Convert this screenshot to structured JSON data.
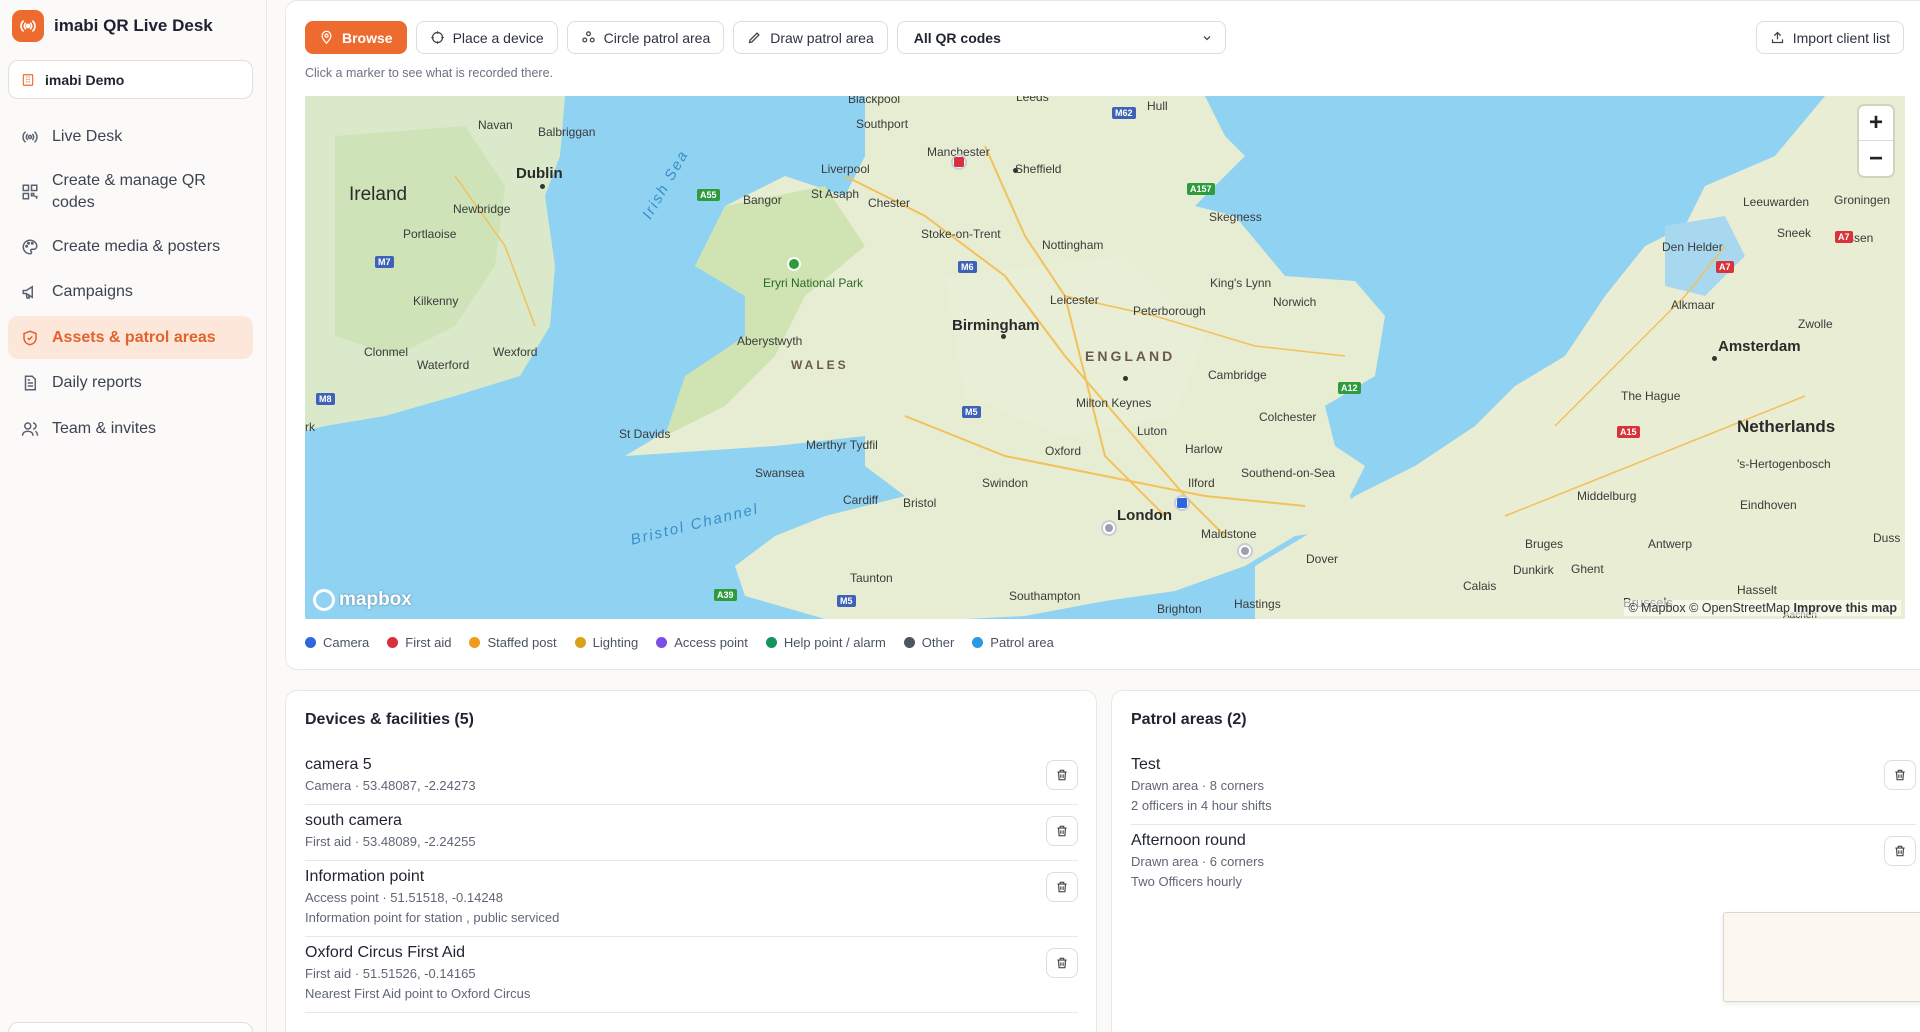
{
  "app": {
    "name": "imabi QR Live Desk",
    "org": "imabi Demo",
    "accent": "#ee6b2f"
  },
  "nav": [
    {
      "label": "Live Desk",
      "icon": "broadcast-icon"
    },
    {
      "label": "Create & manage QR codes",
      "icon": "qr-code-icon"
    },
    {
      "label": "Create media & posters",
      "icon": "palette-icon"
    },
    {
      "label": "Campaigns",
      "icon": "megaphone-icon"
    },
    {
      "label": "Assets & patrol areas",
      "icon": "shield-icon",
      "active": true
    },
    {
      "label": "Daily reports",
      "icon": "document-icon"
    },
    {
      "label": "Team & invites",
      "icon": "users-icon"
    }
  ],
  "toolbar": {
    "browse": "Browse",
    "place_device": "Place a device",
    "circle_patrol": "Circle patrol area",
    "draw_patrol": "Draw patrol area",
    "filter_value": "All QR codes",
    "import": "Import client list",
    "hint": "Click a marker to see what is recorded there."
  },
  "map": {
    "countries": {
      "ireland": "Ireland",
      "netherlands": "Netherlands"
    },
    "regions": {
      "england": "ENGLAND",
      "wales": "WALES"
    },
    "seas": {
      "irish_sea": "Irish Sea",
      "bristol_channel": "Bristol Channel"
    },
    "places": {
      "dublin": "Dublin",
      "navan": "Navan",
      "balbriggan": "Balbriggan",
      "newbridge": "Newbridge",
      "portlaoise": "Portlaoise",
      "kilkenny": "Kilkenny",
      "clonmel": "Clonmel",
      "waterford": "Waterford",
      "wexford": "Wexford",
      "cork": "rk",
      "blackpool": "Blackpool",
      "southport": "Southport",
      "liverpool": "Liverpool",
      "manchester": "Manchester",
      "leeds": "Leeds",
      "hull": "Hull",
      "sheffield": "Sheffield",
      "bangor": "Bangor",
      "st_asaph": "St Asaph",
      "chester": "Chester",
      "stoke": "Stoke-on-Trent",
      "nottingham": "Nottingham",
      "skegness": "Skegness",
      "eryri": "Eryri National Park",
      "kings_lynn": "King's Lynn",
      "norwich": "Norwich",
      "leicester": "Leicester",
      "birmingham": "Birmingham",
      "peterborough": "Peterborough",
      "aberystwyth": "Aberystwyth",
      "cambridge": "Cambridge",
      "milton_keynes": "Milton Keynes",
      "colchester": "Colchester",
      "luton": "Luton",
      "st_davids": "St Davids",
      "merthyr": "Merthyr Tydfil",
      "oxford": "Oxford",
      "harlow": "Harlow",
      "southend": "Southend-on-Sea",
      "swansea": "Swansea",
      "swindon": "Swindon",
      "cardiff": "Cardiff",
      "bristol": "Bristol",
      "ilford": "Ilford",
      "london": "London",
      "maidstone": "Maidstone",
      "dover": "Dover",
      "taunton": "Taunton",
      "southampton": "Southampton",
      "brighton": "Brighton",
      "hastings": "Hastings",
      "leeuwarden": "Leeuwarden",
      "groningen": "Groningen",
      "sneek": "Sneek",
      "assen": "Assen",
      "den_helder": "Den Helder",
      "alkmaar": "Alkmaar",
      "zwolle": "Zwolle",
      "amsterdam": "Amsterdam",
      "the_hague": "The Hague",
      "s_hertogenbosch": "'s-Hertogenbosch",
      "middelburg": "Middelburg",
      "eindhoven": "Eindhoven",
      "bruges": "Bruges",
      "antwerp": "Antwerp",
      "calais": "Calais",
      "dunkirk": "Dunkirk",
      "ghent": "Ghent",
      "hasselt": "Hasselt",
      "brussels": "Brussels",
      "dus": "Duss",
      "aachen": "Aachen"
    },
    "roads": {
      "m62": "M62",
      "a55": "A55",
      "a157": "A157",
      "m6": "M6",
      "m7": "M7",
      "m8": "M8",
      "m5": "M5",
      "a12": "A12",
      "a15": "A15",
      "a7": "A7",
      "a7b": "A7",
      "a39": "A39",
      "m5b": "M5"
    },
    "zoom_in": "+",
    "zoom_out": "−",
    "mapbox": "mapbox",
    "attribution": "© Mapbox © OpenStreetMap",
    "improve": "Improve this map"
  },
  "legend": [
    {
      "label": "Camera",
      "color": "#2f66e0"
    },
    {
      "label": "First aid",
      "color": "#d9303b"
    },
    {
      "label": "Staffed post",
      "color": "#f29a1b"
    },
    {
      "label": "Lighting",
      "color": "#d8a21a"
    },
    {
      "label": "Access point",
      "color": "#7c4ee4"
    },
    {
      "label": "Help point / alarm",
      "color": "#16935f"
    },
    {
      "label": "Other",
      "color": "#4d5563"
    },
    {
      "label": "Patrol area",
      "color": "#2b9ae0"
    }
  ],
  "devices": {
    "title": "Devices & facilities (5)",
    "items": [
      {
        "name": "camera 5",
        "meta": "Camera · 53.48087, -2.24273",
        "note": ""
      },
      {
        "name": "south camera",
        "meta": "First aid · 53.48089, -2.24255",
        "note": ""
      },
      {
        "name": "Information point",
        "meta": "Access point · 51.51518, -0.14248",
        "note": "Information point for station , public serviced"
      },
      {
        "name": "Oxford Circus First Aid",
        "meta": "First aid · 51.51526, -0.14165",
        "note": "Nearest First Aid point to Oxford Circus"
      }
    ]
  },
  "patrols": {
    "title": "Patrol areas (2)",
    "items": [
      {
        "name": "Test",
        "meta": "Drawn area · 8 corners",
        "note": "2 officers in 4 hour shifts"
      },
      {
        "name": "Afternoon round",
        "meta": "Drawn area · 6 corners",
        "note": "Two Officers hourly"
      }
    ]
  }
}
